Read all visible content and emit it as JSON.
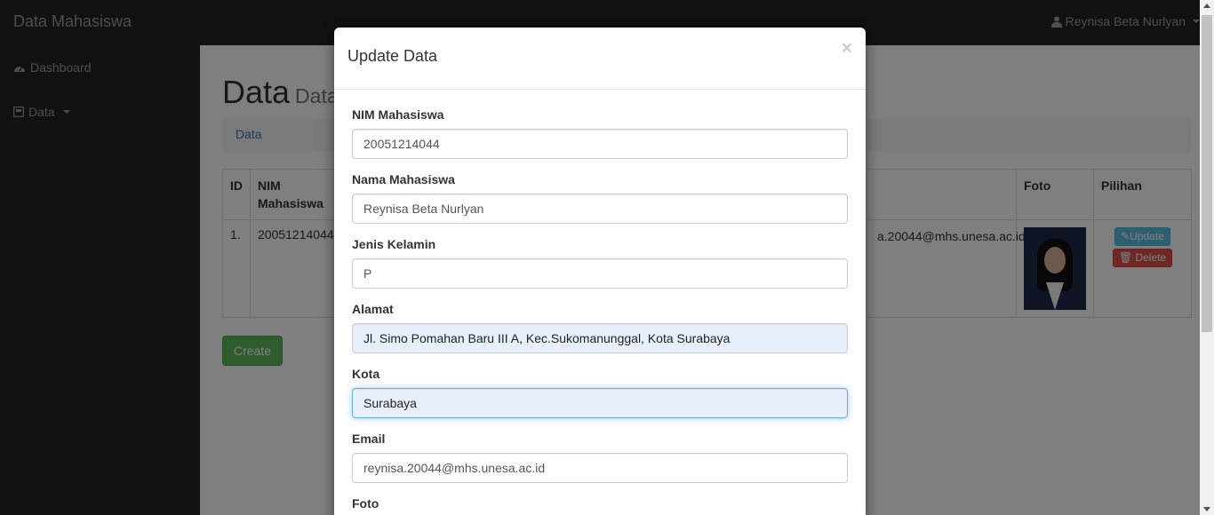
{
  "navbar": {
    "brand": "Data Mahasiswa",
    "user_name": "Reynisa Beta Nurlyan"
  },
  "sidebar": {
    "items": [
      {
        "label": "Dashboard",
        "icon": "dashboard-icon"
      },
      {
        "label": "Data",
        "icon": "box-icon"
      }
    ]
  },
  "page": {
    "title": "Data",
    "subtitle": "Data",
    "breadcrumb": "Data"
  },
  "table": {
    "headers": {
      "id": "ID",
      "nim": "NIM Mahasiswa",
      "foto": "Foto",
      "pilihan": "Pilihan"
    },
    "row": {
      "id": "1.",
      "nim": "20051214044",
      "email": "a.20044@mhs.unesa.ac.id",
      "update": "Update",
      "delete": "Delete"
    }
  },
  "create_button": "Create",
  "modal": {
    "title": "Update Data",
    "close": "×",
    "fields": {
      "nim": {
        "label": "NIM Mahasiswa",
        "value": "20051214044"
      },
      "nama": {
        "label": "Nama Mahasiswa",
        "value": "Reynisa Beta Nurlyan"
      },
      "jenis_kelamin": {
        "label": "Jenis Kelamin",
        "value": "P"
      },
      "alamat": {
        "label": "Alamat",
        "value": "Jl. Simo Pomahan Baru III A, Kec.Sukomanunggal, Kota Surabaya"
      },
      "kota": {
        "label": "Kota",
        "value": "Surabaya"
      },
      "email": {
        "label": "Email",
        "value": "reynisa.20044@mhs.unesa.ac.id"
      },
      "foto": {
        "label": "Foto"
      }
    }
  },
  "colors": {
    "navbar": "#222222",
    "primary_link": "#337ab7",
    "success": "#5cb85c",
    "info": "#5bc0de",
    "danger": "#d9534f"
  }
}
